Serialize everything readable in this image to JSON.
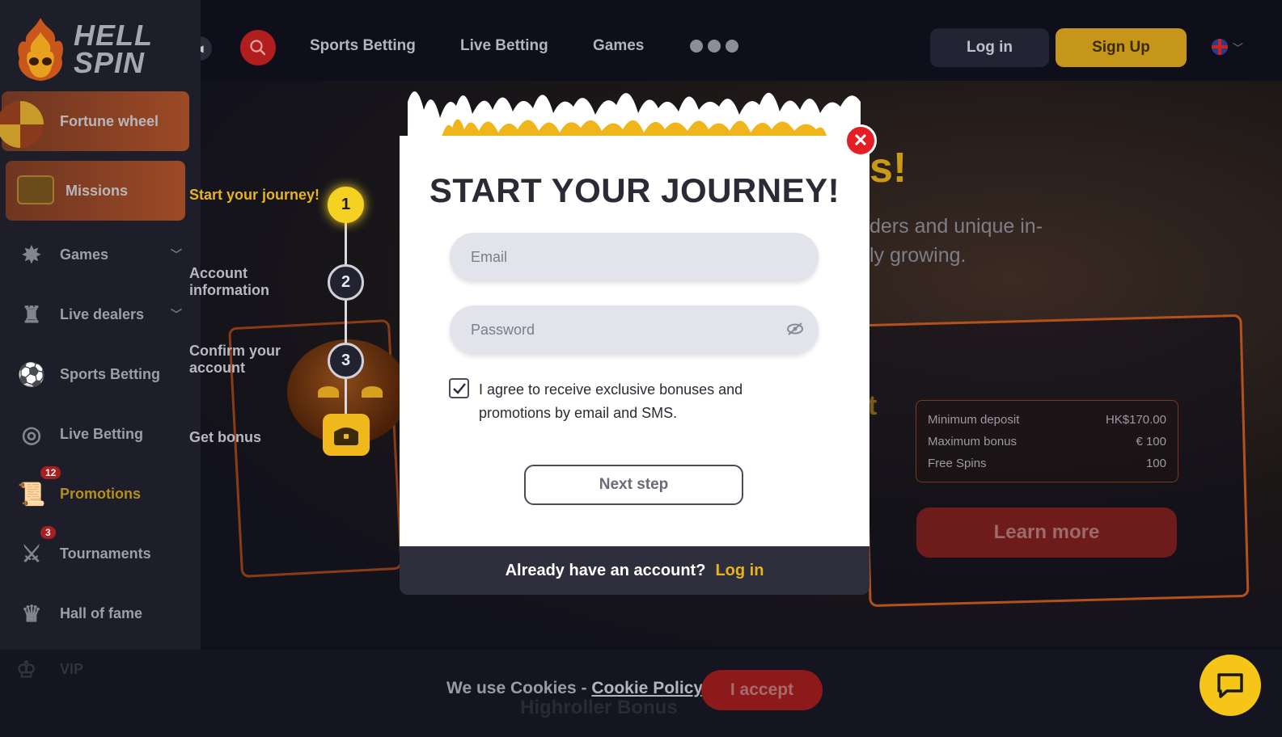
{
  "brand": {
    "logo_line1": "HELL",
    "logo_line2": "SPIN"
  },
  "header": {
    "nav": [
      "Sports Betting",
      "Live Betting",
      "Games"
    ],
    "login_label": "Log in",
    "signup_label": "Sign Up"
  },
  "sidebar": {
    "fortune_wheel": "Fortune wheel",
    "missions": "Missions",
    "items": [
      {
        "label": "Games",
        "icon": "games-icon"
      },
      {
        "label": "Live dealers",
        "icon": "live-dealers-icon"
      },
      {
        "label": "Sports Betting",
        "icon": "soccer-ball-icon"
      },
      {
        "label": "Live Betting",
        "icon": "live-betting-icon"
      },
      {
        "label": "Promotions",
        "icon": "promotions-scroll-icon",
        "badge": "12"
      },
      {
        "label": "Tournaments",
        "icon": "tournaments-shield-icon",
        "badge": "3"
      },
      {
        "label": "Hall of fame",
        "icon": "hall-of-fame-icon"
      },
      {
        "label": "VIP",
        "icon": "crown-icon"
      }
    ]
  },
  "steps": {
    "labels": [
      "Start your journey!",
      "Account information",
      "Confirm your account",
      "Get bonus"
    ],
    "numbers": [
      "1",
      "2",
      "3"
    ],
    "active_index": 0
  },
  "modal": {
    "title": "START YOUR JOURNEY!",
    "email_placeholder": "Email",
    "password_placeholder": "Password",
    "agree_text": "I agree to receive exclusive bonuses and promotions by email and SMS.",
    "agree_checked": true,
    "next_label": "Next step",
    "footer_text": "Already have an account?",
    "footer_link": "Log in"
  },
  "hero": {
    "title_fragment": "s!",
    "text_line1": "ders and unique in-",
    "text_line2": "ly growing.",
    "letter_fragment": "t",
    "bonus_rows": [
      {
        "label": "Minimum deposit",
        "value": "HK$170.00"
      },
      {
        "label": "Maximum bonus",
        "value": "€ 100"
      },
      {
        "label": "Free Spins",
        "value": "100"
      }
    ],
    "learn_more": "Learn more",
    "highroller": "Highroller Bonus"
  },
  "cookie": {
    "text": "We use Cookies - ",
    "policy_link": "Cookie Policy",
    "period": ".",
    "accept_label": "I accept"
  },
  "colors": {
    "accent_yellow": "#f5c518",
    "accent_red": "#e31e24",
    "gold_button": "#c6961b"
  }
}
